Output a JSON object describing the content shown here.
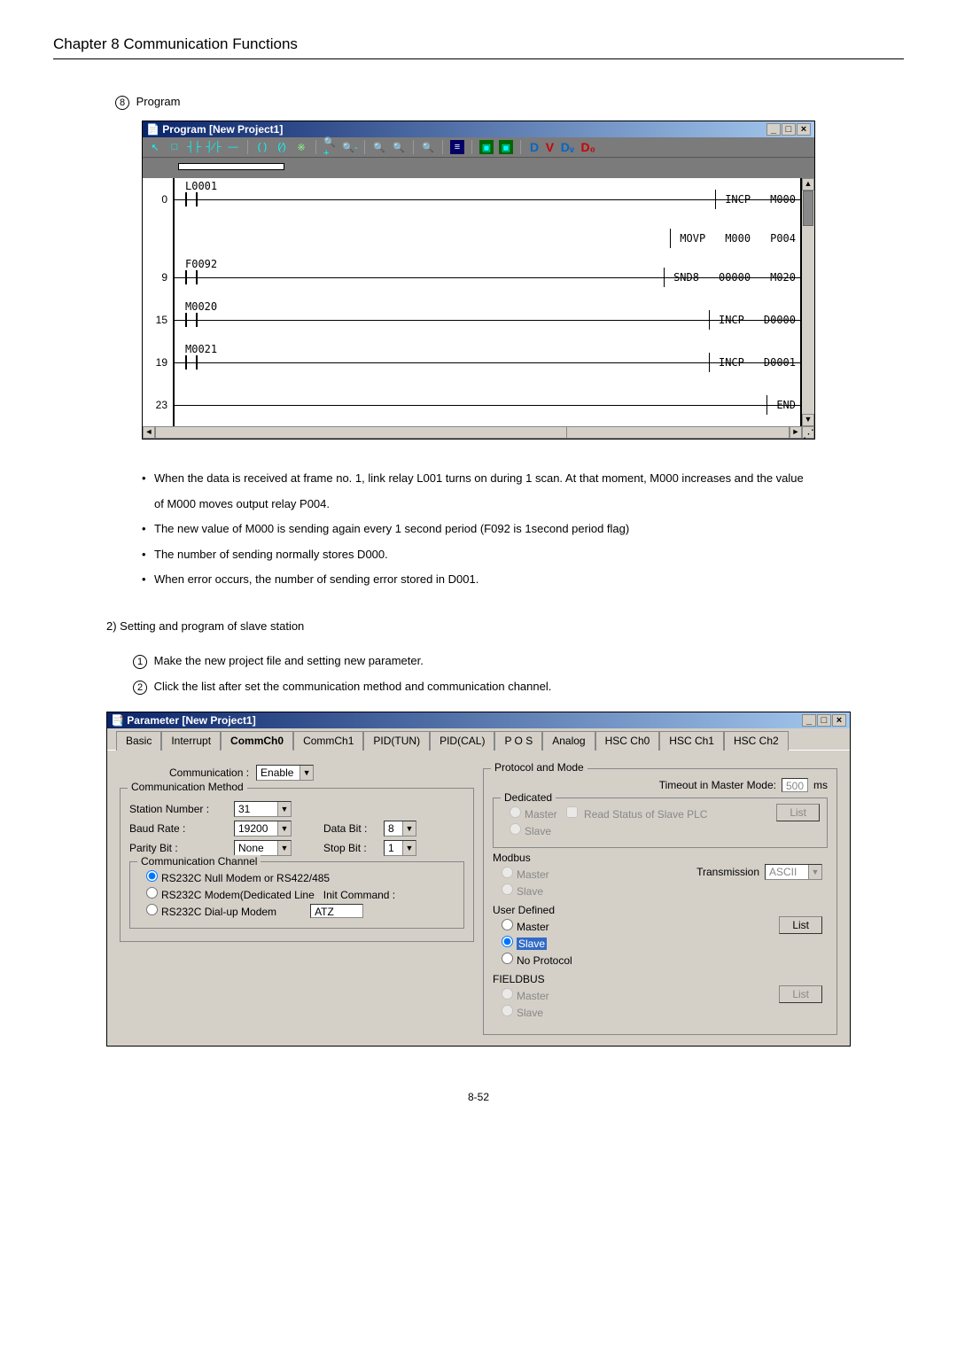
{
  "chapter": "Chapter 8   Communication Functions",
  "section8": {
    "num": "8",
    "label": "Program"
  },
  "program_window": {
    "title": "Program [New Project1]",
    "toolbar_letters": {
      "D": "D",
      "V": "V",
      "Dv": "Dᵥ",
      "D0": "D₀"
    },
    "rows": [
      {
        "step": "0",
        "contact": "L0001",
        "ops": [
          "INCP",
          "M000"
        ],
        "extra": {
          "op": "MOVP",
          "a": "M000",
          "b": "P004"
        }
      },
      {
        "step": "9",
        "contact": "F0092",
        "ops": [
          "SND8",
          "00000",
          "M020"
        ]
      },
      {
        "step": "15",
        "contact": "M0020",
        "ops": [
          "INCP",
          "D0000"
        ]
      },
      {
        "step": "19",
        "contact": "M0021",
        "ops": [
          "INCP",
          "D0001"
        ]
      },
      {
        "step": "23",
        "contact": "",
        "ops": [
          "END"
        ]
      }
    ]
  },
  "bullets": [
    "When the data is received at frame no. 1, link relay L001 turns on during 1 scan. At that moment, M000 increases and the value of M000 moves output relay P004.",
    "The new value of M000 is sending again every 1 second period (F092 is 1second period flag)",
    "The number of sending normally stores D000.",
    "When error occurs, the number of sending error stored in D001."
  ],
  "subheading": "2) Setting and program of slave station",
  "steps": [
    {
      "n": "1",
      "text": "Make the new project file and setting new parameter."
    },
    {
      "n": "2",
      "text": "Click the list after set the communication method and communication channel."
    }
  ],
  "param_window": {
    "title": "Parameter [New Project1]",
    "tabs": [
      "Basic",
      "Interrupt",
      "CommCh0",
      "CommCh1",
      "PID(TUN)",
      "PID(CAL)",
      "P O S",
      "Analog",
      "HSC Ch0",
      "HSC Ch1",
      "HSC Ch2"
    ],
    "active_tab": "CommCh0",
    "communication_label": "Communication :",
    "communication_value": "Enable",
    "comm_method_legend": "Communication Method",
    "station_label": "Station Number :",
    "station_value": "31",
    "baud_label": "Baud Rate :",
    "baud_value": "19200",
    "data_label": "Data Bit :",
    "data_value": "8",
    "parity_label": "Parity Bit :",
    "parity_value": "None",
    "stop_label": "Stop Bit :",
    "stop_value": "1",
    "comm_channel_legend": "Communication Channel",
    "ch_opts": [
      "RS232C Null Modem or RS422/485",
      "RS232C Modem(Dedicated Line",
      "RS232C Dial-up Modem"
    ],
    "init_cmd_label": "Init Command :",
    "init_cmd_value": "ATZ",
    "protocol_legend": "Protocol and Mode",
    "timeout_label": "Timeout in Master Mode:",
    "timeout_value": "500",
    "timeout_unit": "ms",
    "dedicated_label": "Dedicated",
    "read_status": "Read Status of Slave PLC",
    "list_btn": "List",
    "modbus_label": "Modbus",
    "transmission_label": "Transmission",
    "transmission_value": "ASCII",
    "userdef_label": "User Defined",
    "master": "Master",
    "slave": "Slave",
    "noprotocol": "No Protocol",
    "fieldbus_label": "FIELDBUS"
  },
  "page_footer": "8-52"
}
